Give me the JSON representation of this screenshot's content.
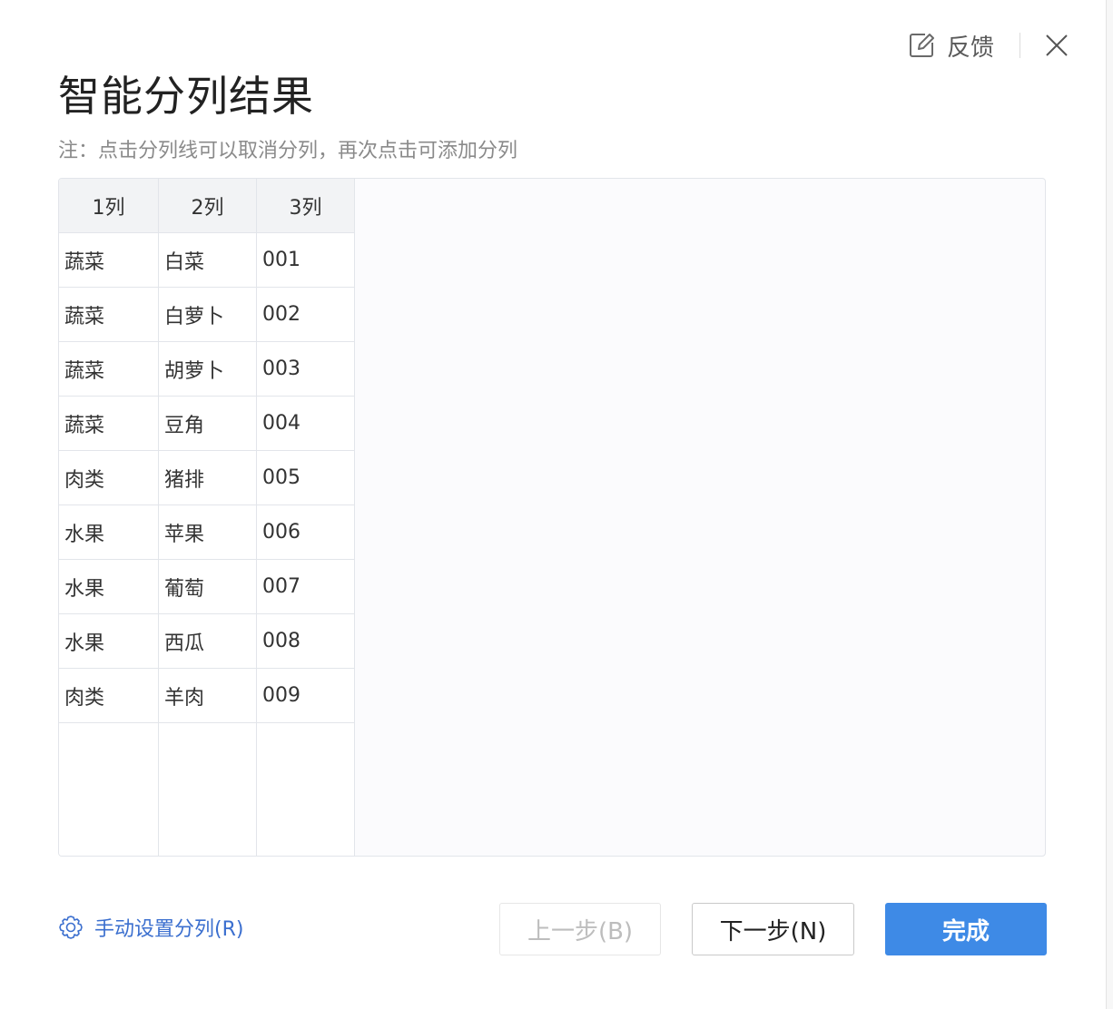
{
  "header": {
    "feedback_label": "反馈",
    "title": "智能分列结果",
    "note": "注：点击分列线可以取消分列，再次点击可添加分列"
  },
  "table": {
    "columns": [
      "1列",
      "2列",
      "3列"
    ],
    "rows": [
      [
        "蔬菜",
        "白菜",
        "001"
      ],
      [
        "蔬菜",
        "白萝卜",
        "002"
      ],
      [
        "蔬菜",
        "胡萝卜",
        "003"
      ],
      [
        "蔬菜",
        "豆角",
        "004"
      ],
      [
        "肉类",
        "猪排",
        "005"
      ],
      [
        "水果",
        "苹果",
        "006"
      ],
      [
        "水果",
        "葡萄",
        "007"
      ],
      [
        "水果",
        "西瓜",
        "008"
      ],
      [
        "肉类",
        "羊肉",
        "009"
      ]
    ]
  },
  "footer": {
    "manual_label": "手动设置分列(R)",
    "prev_label": "上一步(B)",
    "next_label": "下一步(N)",
    "done_label": "完成"
  },
  "icons": {
    "feedback": "edit-icon",
    "close": "close-icon",
    "manual": "gear-icon"
  },
  "colors": {
    "accent": "#3e8ae6",
    "link": "#3b6fcf"
  }
}
